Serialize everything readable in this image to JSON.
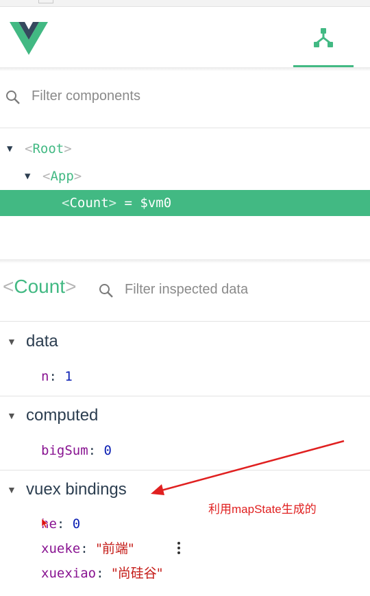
{
  "accent_color": "#42b983",
  "annotation_color": "#e02020",
  "icons": {
    "logo": "vue-logo",
    "tree_tab": "component-tree-icon",
    "search": "search-icon"
  },
  "component_filter": {
    "placeholder": "Filter components"
  },
  "tree": [
    {
      "open": "<",
      "name": "Root",
      "close": ">",
      "ref": ""
    },
    {
      "open": "<",
      "name": "App",
      "close": ">",
      "ref": ""
    },
    {
      "open": "<",
      "name": "Count",
      "close": ">",
      "ref": " = $vm0"
    }
  ],
  "inspector": {
    "open": "<",
    "name": "Count",
    "close": ">",
    "filter_placeholder": "Filter inspected data"
  },
  "sections": {
    "data": {
      "title": "data",
      "props": [
        {
          "key": "n",
          "value": "1"
        }
      ]
    },
    "computed": {
      "title": "computed",
      "props": [
        {
          "key": "bigSum",
          "value": "0"
        }
      ]
    },
    "vuex": {
      "title": "vuex bindings",
      "props": [
        {
          "key": "he",
          "value": "0"
        },
        {
          "key": "xueke",
          "value": "\"前端\""
        },
        {
          "key": "xuexiao",
          "value": "\"尚硅谷\""
        }
      ]
    }
  },
  "annotation": {
    "text": "利用mapState生成的"
  }
}
